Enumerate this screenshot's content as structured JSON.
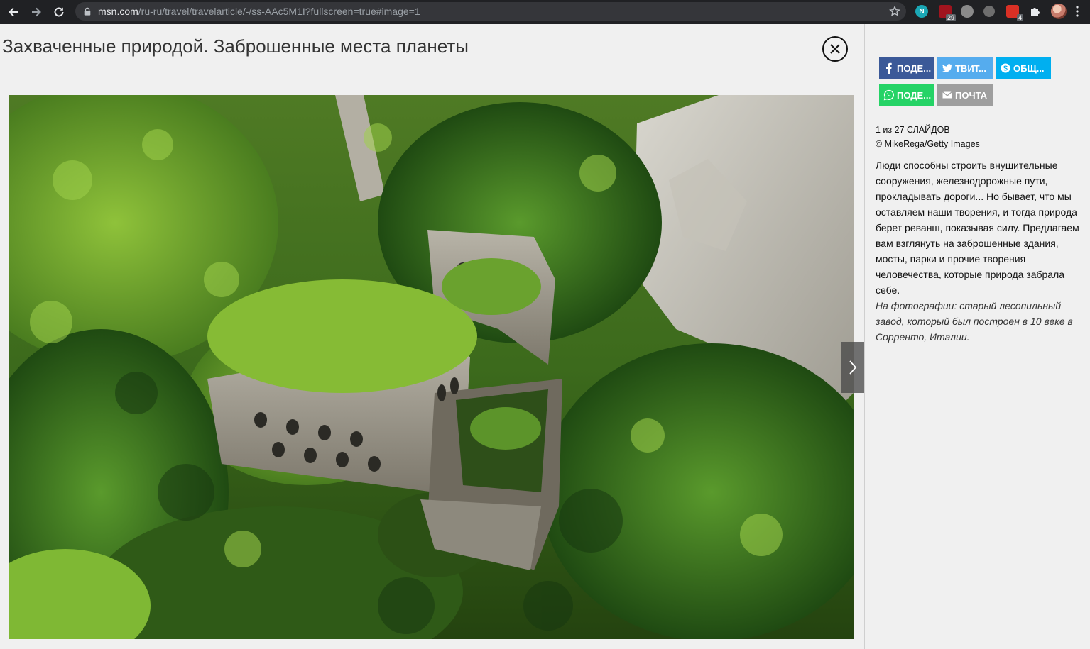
{
  "browser": {
    "url_host": "msn.com",
    "url_path": "/ru-ru/travel/travelarticle/-/ss-AAc5M1I?fullscreen=true#image=1",
    "extensions": [
      {
        "name": "n-extension",
        "badge": "",
        "color": "#1aa7b5"
      },
      {
        "name": "ublock-extension",
        "badge": "29",
        "color": "#a0141e"
      },
      {
        "name": "gray-extension",
        "badge": "",
        "color": "#8a8a8a"
      },
      {
        "name": "bomb-extension",
        "badge": "",
        "color": "#6e6e6e"
      },
      {
        "name": "red-extension",
        "badge": "4",
        "color": "#d93025"
      },
      {
        "name": "puzzle-extension",
        "badge": "",
        "color": "#e8eaed"
      },
      {
        "name": "profile-avatar",
        "badge": "",
        "color": "#c77b6b"
      }
    ]
  },
  "slideshow": {
    "title": "Захваченные природой. Заброшенные места планеты",
    "share": {
      "facebook": "ПОДЕ...",
      "twitter": "ТВИТ...",
      "skype": "ОБЩ...",
      "whatsapp": "ПОДЕ...",
      "mail": "ПОЧТА"
    },
    "colors": {
      "facebook": "#3b5998",
      "twitter": "#55acee",
      "skype": "#00aff0",
      "whatsapp": "#25d366",
      "mail": "#9e9e9e"
    },
    "slide_count": "1 из 27 СЛАЙДОВ",
    "credit": "© MikeRega/Getty Images",
    "description": "Люди способны строить внушительные сооружения, железнодорожные пути, прокладывать дороги... Но бывает, что мы оставляем наши творения, и тогда природа берет реванш, показывая силу. Предлагаем вам взглянуть на заброшенные здания, мосты, парки и прочие творения человечества, которые природа забрала себе.",
    "photo_note": "На фотографии: старый лесопильный завод, который был построен в 10 веке в Сорренто, Италии."
  }
}
